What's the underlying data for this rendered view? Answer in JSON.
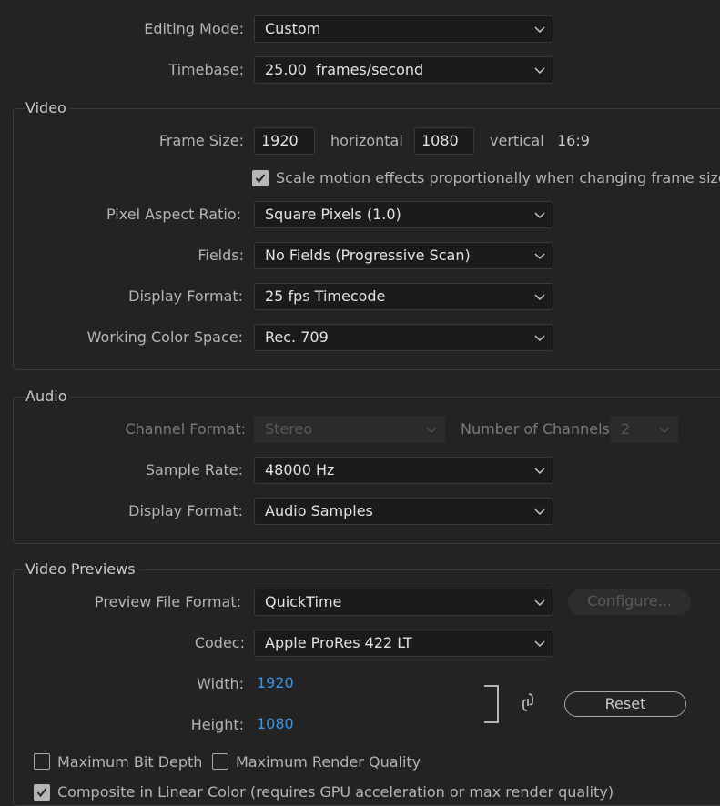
{
  "general": {
    "editing_mode_label": "Editing Mode:",
    "editing_mode_value": "Custom",
    "timebase_label": "Timebase:",
    "timebase_value": "25.00  frames/second"
  },
  "video": {
    "title": "Video",
    "frame_size_label": "Frame Size:",
    "frame_width": "1920",
    "horizontal_label": "horizontal",
    "frame_height": "1080",
    "vertical_label": "vertical",
    "aspect": "16:9",
    "scale_motion_label": "Scale motion effects proportionally when changing frame size",
    "scale_motion_checked": true,
    "pixel_aspect_label": "Pixel Aspect Ratio:",
    "pixel_aspect_value": "Square Pixels (1.0)",
    "fields_label": "Fields:",
    "fields_value": "No Fields (Progressive Scan)",
    "display_format_label": "Display Format:",
    "display_format_value": "25 fps Timecode",
    "color_space_label": "Working Color Space:",
    "color_space_value": "Rec. 709"
  },
  "audio": {
    "title": "Audio",
    "channel_format_label": "Channel Format:",
    "channel_format_value": "Stereo",
    "num_channels_label": "Number of Channels:",
    "num_channels_value": "2",
    "sample_rate_label": "Sample Rate:",
    "sample_rate_value": "48000 Hz",
    "display_format_label": "Display Format:",
    "display_format_value": "Audio Samples"
  },
  "previews": {
    "title": "Video Previews",
    "file_format_label": "Preview File Format:",
    "file_format_value": "QuickTime",
    "configure_label": "Configure...",
    "codec_label": "Codec:",
    "codec_value": "Apple ProRes 422 LT",
    "width_label": "Width:",
    "width_value": "1920",
    "height_label": "Height:",
    "height_value": "1080",
    "reset_label": "Reset",
    "max_bit_depth_label": "Maximum Bit Depth",
    "max_render_quality_label": "Maximum Render Quality",
    "composite_label": "Composite in Linear Color (requires GPU acceleration or max render quality)"
  },
  "colors": {
    "background": "#232323",
    "accent_link": "#3b93e9"
  }
}
